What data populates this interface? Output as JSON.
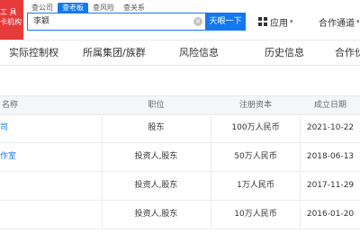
{
  "header": {
    "logo_lines": [
      "工 具",
      "卡机构"
    ],
    "search_tabs": [
      "查公司",
      "查老板",
      "查风险",
      "查关系"
    ],
    "search_value": "李颖",
    "search_button": "天眼一下",
    "app_menu": "应用",
    "channel_menu": "合作通道"
  },
  "nav": {
    "items": [
      "实际控制权",
      "所属集团/族群",
      "风险信息",
      "历史信息",
      "合作伙"
    ]
  },
  "table": {
    "columns": [
      "名称",
      "职位",
      "注册资本",
      "成立日期"
    ],
    "rows": [
      {
        "name": "司",
        "position": "股东",
        "capital": "100万人民币",
        "date": "2021-10-22"
      },
      {
        "name": "作室",
        "position": "投资人,股东",
        "capital": "50万人民币",
        "date": "2018-06-13"
      },
      {
        "name": "",
        "position": "投资人,股东",
        "capital": "1万人民币",
        "date": "2017-11-29"
      },
      {
        "name": "",
        "position": "投资人,股东",
        "capital": "10万人民币",
        "date": "2016-01-20"
      }
    ]
  },
  "colors": {
    "accent": "#1478f0",
    "logo": "#e63b3b"
  }
}
